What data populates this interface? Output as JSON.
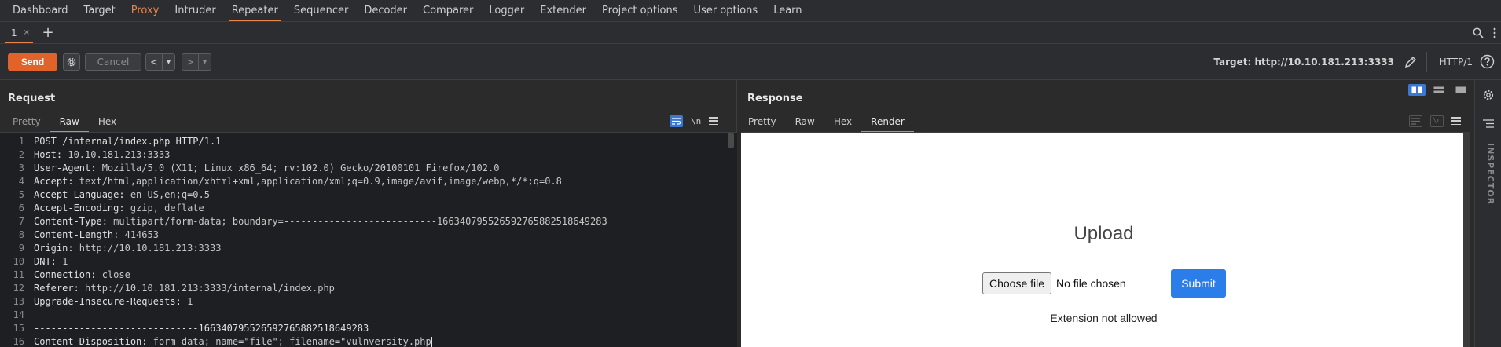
{
  "menu": [
    {
      "label": "Dashboard"
    },
    {
      "label": "Target"
    },
    {
      "label": "Proxy"
    },
    {
      "label": "Intruder"
    },
    {
      "label": "Repeater"
    },
    {
      "label": "Sequencer"
    },
    {
      "label": "Decoder"
    },
    {
      "label": "Comparer"
    },
    {
      "label": "Logger"
    },
    {
      "label": "Extender"
    },
    {
      "label": "Project options"
    },
    {
      "label": "User options"
    },
    {
      "label": "Learn"
    }
  ],
  "tabs": {
    "current": "1",
    "close": "×",
    "add": "+"
  },
  "toolbar": {
    "send": "Send",
    "cancel": "Cancel",
    "back": "<",
    "back_menu": "▾",
    "forward": ">",
    "forward_menu": "▾",
    "target": "Target: http://10.10.181.213:3333",
    "protocol": "HTTP/1"
  },
  "request": {
    "title": "Request",
    "tabs": [
      "Pretty",
      "Raw",
      "Hex"
    ],
    "newline_toggle": "\\n",
    "lines": [
      {
        "n": "1",
        "key": "POST /internal/index.php HTTP/1.1",
        "val": ""
      },
      {
        "n": "2",
        "key": "Host:",
        "val": " 10.10.181.213:3333"
      },
      {
        "n": "3",
        "key": "User-Agent:",
        "val": " Mozilla/5.0 (X11; Linux x86_64; rv:102.0) Gecko/20100101 Firefox/102.0"
      },
      {
        "n": "4",
        "key": "Accept:",
        "val": " text/html,application/xhtml+xml,application/xml;q=0.9,image/avif,image/webp,*/*;q=0.8"
      },
      {
        "n": "5",
        "key": "Accept-Language:",
        "val": " en-US,en;q=0.5"
      },
      {
        "n": "6",
        "key": "Accept-Encoding:",
        "val": " gzip, deflate"
      },
      {
        "n": "7",
        "key": "Content-Type:",
        "val": " multipart/form-data; boundary=---------------------------166340795526592765882518649283"
      },
      {
        "n": "8",
        "key": "Content-Length:",
        "val": " 414653"
      },
      {
        "n": "9",
        "key": "Origin:",
        "val": " http://10.10.181.213:3333"
      },
      {
        "n": "10",
        "key": "DNT:",
        "val": " 1"
      },
      {
        "n": "11",
        "key": "Connection:",
        "val": " close"
      },
      {
        "n": "12",
        "key": "Referer:",
        "val": " http://10.10.181.213:3333/internal/index.php"
      },
      {
        "n": "13",
        "key": "Upgrade-Insecure-Requests:",
        "val": " 1"
      },
      {
        "n": "14",
        "key": "",
        "val": ""
      },
      {
        "n": "15",
        "key": "-----------------------------166340795526592765882518649283",
        "val": ""
      },
      {
        "n": "16",
        "key": "Content-Disposition:",
        "val": " form-data; name=\"file\"; filename=\"vulnversity.php"
      }
    ]
  },
  "response": {
    "title": "Response",
    "tabs": [
      "Pretty",
      "Raw",
      "Hex",
      "Render"
    ],
    "render": {
      "heading": "Upload",
      "choose_file": "Choose file",
      "no_file": "No file chosen",
      "submit": "Submit",
      "message": "Extension not allowed"
    }
  },
  "inspector": {
    "label": "INSPECTOR"
  },
  "colors": {
    "accent": "#e8834b",
    "send": "#e2632a",
    "blue": "#3b78d6",
    "submit": "#2b7de9"
  }
}
